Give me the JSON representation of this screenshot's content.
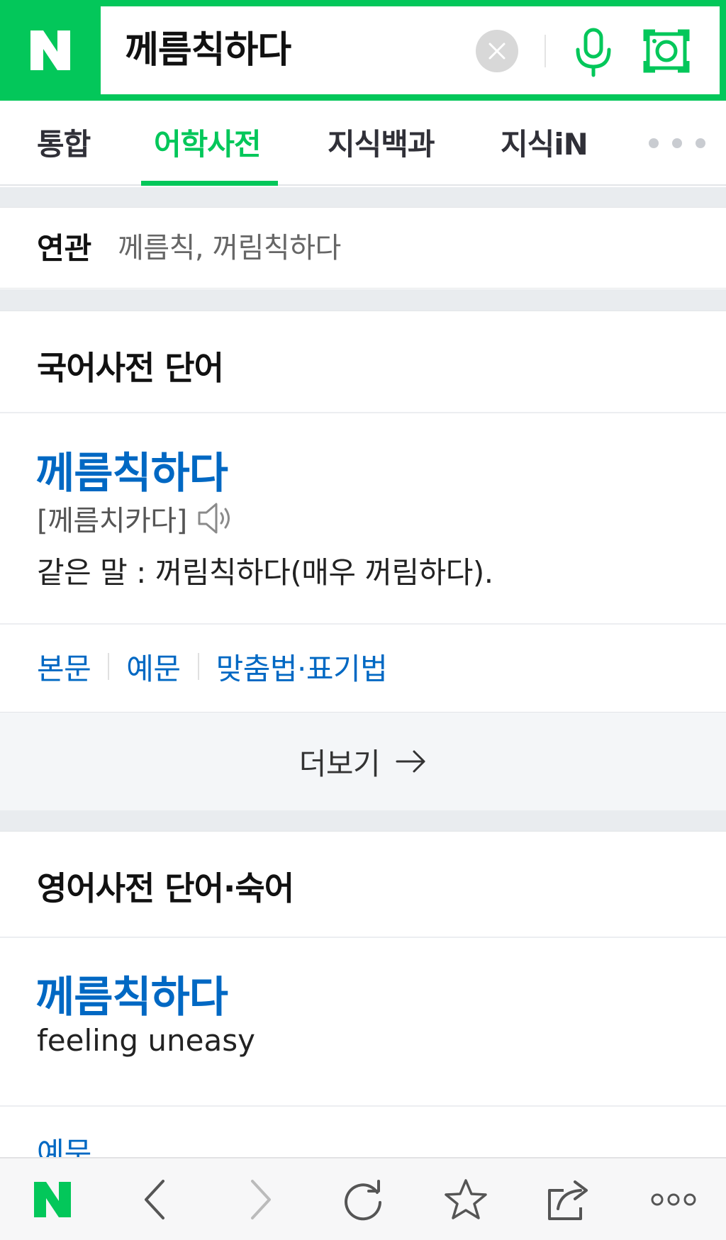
{
  "search": {
    "logo": "N",
    "query": "께름칙하다"
  },
  "tabs": [
    {
      "label": "통합"
    },
    {
      "label": "어학사전",
      "active": true
    },
    {
      "label": "지식백과"
    },
    {
      "label": "지식iN"
    }
  ],
  "related": {
    "label": "연관",
    "items": "께름칙, 꺼림칙하다"
  },
  "korean_dict": {
    "section_title": "국어사전 단어",
    "word": "께름칙하다",
    "pronunciation": "[께름치카다]",
    "definition": "같은 말 : 꺼림칙하다(매우 꺼림하다).",
    "links": [
      "본문",
      "예문",
      "맞춤법·표기법"
    ],
    "more_label": "더보기"
  },
  "english_dict": {
    "section_title": "영어사전 단어·숙어",
    "word": "께름칙하다",
    "meaning": "feeling uneasy",
    "link": "예문"
  },
  "bottom_nav": {
    "logo": "N"
  },
  "colors": {
    "brand_green": "#03c75a",
    "link_blue": "#0068c3"
  }
}
